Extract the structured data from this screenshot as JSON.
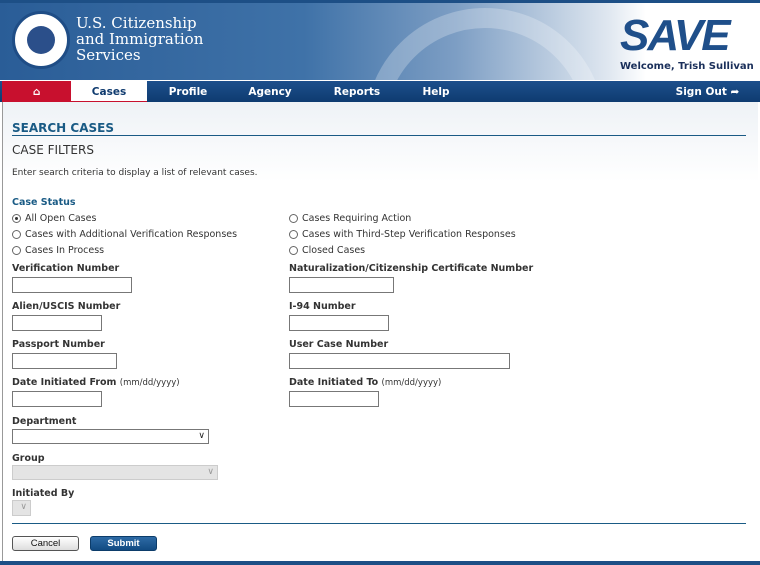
{
  "header": {
    "agency_line1": "U.S. Citizenship",
    "agency_line2": "and Immigration",
    "agency_line3": "Services",
    "logo": "SAVE",
    "welcome": "Welcome, Trish Sullivan"
  },
  "nav": {
    "home_icon": "home-icon",
    "items": [
      "Cases",
      "Profile",
      "Agency",
      "Reports",
      "Help"
    ],
    "sign_out": "Sign Out",
    "sign_out_icon": "sign-out-icon"
  },
  "page": {
    "title": "SEARCH CASES",
    "subtitle": "CASE FILTERS",
    "instructions": "Enter search criteria to display a list of relevant cases."
  },
  "case_status": {
    "label": "Case Status",
    "options": [
      "All Open Cases",
      "Cases with Additional Verification Responses",
      "Cases In Process",
      "Cases Requiring Action",
      "Cases with Third-Step Verification Responses",
      "Closed Cases"
    ],
    "selected": "All Open Cases"
  },
  "fields": {
    "verification_number": "Verification Number",
    "naturalization": "Naturalization/Citizenship Certificate Number",
    "alien": "Alien/USCIS Number",
    "i94": "I-94 Number",
    "passport": "Passport Number",
    "user_case": "User Case Number",
    "date_from": "Date Initiated From",
    "date_to": "Date Initiated To",
    "date_hint": "(mm/dd/yyyy)",
    "department": "Department",
    "group": "Group",
    "initiated_by": "Initiated By"
  },
  "buttons": {
    "cancel": "Cancel",
    "submit": "Submit"
  }
}
